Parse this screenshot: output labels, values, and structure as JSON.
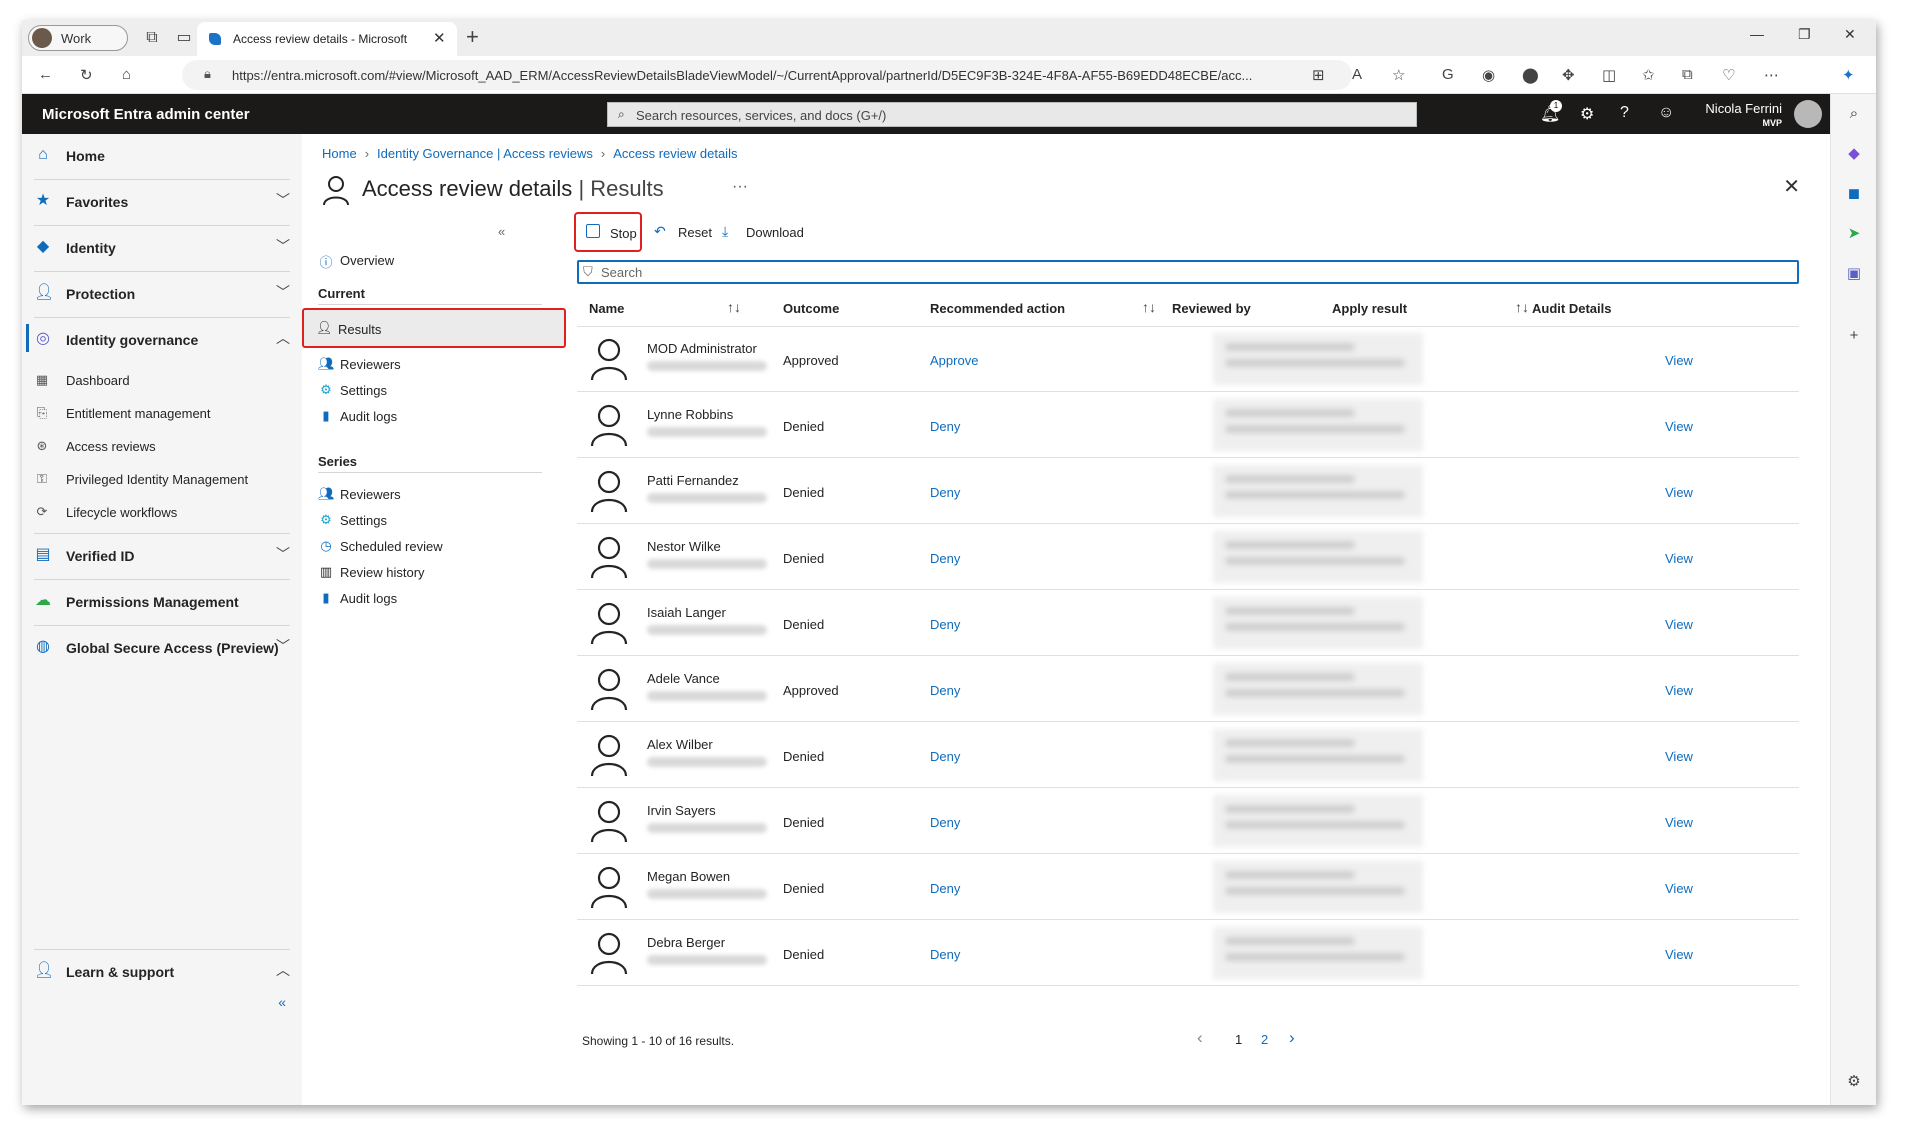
{
  "browser": {
    "profile_label": "Work",
    "tab_title": "Access review details - Microsoft",
    "url": "https://entra.microsoft.com/#view/Microsoft_AAD_ERM/AccessReviewDetailsBladeViewModel/~/CurrentApproval/partnerId/D5EC9F3B-324E-4F8A-AF55-B69EDD48ECBE/acc..."
  },
  "portal": {
    "title": "Microsoft Entra admin center",
    "search_placeholder": "Search resources, services, and docs (G+/)",
    "notification_count": "1",
    "user_name": "Nicola Ferrini",
    "user_badge": "MVP"
  },
  "left_nav": {
    "top_items": [
      {
        "label": "Home"
      },
      {
        "label": "Favorites"
      },
      {
        "label": "Identity"
      },
      {
        "label": "Protection"
      },
      {
        "label": "Identity governance"
      },
      {
        "label": "Verified ID"
      },
      {
        "label": "Permissions Management"
      },
      {
        "label": "Global Secure Access (Preview)"
      },
      {
        "label": "Learn & support"
      }
    ],
    "governance_items": [
      {
        "label": "Dashboard"
      },
      {
        "label": "Entitlement management"
      },
      {
        "label": "Access reviews"
      },
      {
        "label": "Privileged Identity Management"
      },
      {
        "label": "Lifecycle workflows"
      }
    ]
  },
  "breadcrumb": [
    "Home",
    "Identity Governance | Access reviews",
    "Access review details"
  ],
  "page": {
    "title": "Access review details",
    "subtitle": "Results"
  },
  "blade_menu": {
    "overview": "Overview",
    "current_heading": "Current",
    "current_items": [
      "Results",
      "Reviewers",
      "Settings",
      "Audit logs"
    ],
    "series_heading": "Series",
    "series_items": [
      "Reviewers",
      "Settings",
      "Scheduled review",
      "Review history",
      "Audit logs"
    ]
  },
  "toolbar": {
    "stop": "Stop",
    "reset": "Reset",
    "download": "Download"
  },
  "filter": {
    "placeholder": "Search"
  },
  "table": {
    "columns": [
      "Name",
      "Outcome",
      "Recommended action",
      "Reviewed by",
      "Apply result",
      "Audit Details"
    ],
    "rows": [
      {
        "name": "MOD Administrator",
        "outcome": "Approved",
        "action": "Approve",
        "audit": "View"
      },
      {
        "name": "Lynne Robbins",
        "outcome": "Denied",
        "action": "Deny",
        "audit": "View"
      },
      {
        "name": "Patti Fernandez",
        "outcome": "Denied",
        "action": "Deny",
        "audit": "View"
      },
      {
        "name": "Nestor Wilke",
        "outcome": "Denied",
        "action": "Deny",
        "audit": "View"
      },
      {
        "name": "Isaiah Langer",
        "outcome": "Denied",
        "action": "Deny",
        "audit": "View"
      },
      {
        "name": "Adele Vance",
        "outcome": "Approved",
        "action": "Deny",
        "audit": "View"
      },
      {
        "name": "Alex Wilber",
        "outcome": "Denied",
        "action": "Deny",
        "audit": "View"
      },
      {
        "name": "Irvin Sayers",
        "outcome": "Denied",
        "action": "Deny",
        "audit": "View"
      },
      {
        "name": "Megan Bowen",
        "outcome": "Denied",
        "action": "Deny",
        "audit": "View"
      },
      {
        "name": "Debra Berger",
        "outcome": "Denied",
        "action": "Deny",
        "audit": "View"
      }
    ]
  },
  "pagination": {
    "summary": "Showing 1 - 10 of 16 results.",
    "pages": [
      "1",
      "2"
    ]
  },
  "colors": {
    "accent": "#0f6cbd",
    "highlight": "#e02020",
    "header_bg": "#1b1a19"
  }
}
